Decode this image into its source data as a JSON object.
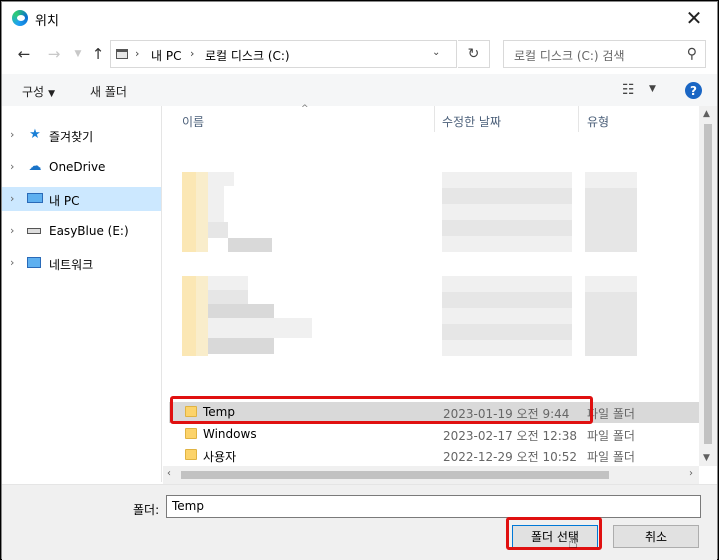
{
  "window": {
    "title": "위치"
  },
  "nav": {
    "breadcrumbs": [
      "내 PC",
      "로컬 디스크 (C:)"
    ],
    "search_placeholder": "로컬 디스크 (C:) 검색"
  },
  "commands": {
    "organize": "구성",
    "new_folder": "새 폴더"
  },
  "sidebar": {
    "items": [
      {
        "label": "즐겨찾기",
        "icon": "star-icon",
        "selected": false
      },
      {
        "label": "OneDrive",
        "icon": "cloud-icon",
        "selected": false
      },
      {
        "label": "내 PC",
        "icon": "computer-icon",
        "selected": true
      },
      {
        "label": "EasyBlue (E:)",
        "icon": "drive-icon",
        "selected": false
      },
      {
        "label": "네트워크",
        "icon": "network-icon",
        "selected": false
      }
    ]
  },
  "columns": {
    "name": "이름",
    "date": "수정한 날짜",
    "type": "유형"
  },
  "files": [
    {
      "name": "Temp",
      "date": "2023-01-19 오전 9:44",
      "type": "파일 폴더",
      "highlighted": true
    },
    {
      "name": "Windows",
      "date": "2023-02-17 오전 12:38",
      "type": "파일 폴더",
      "highlighted": false
    },
    {
      "name": "사용자",
      "date": "2022-12-29 오전 10:52",
      "type": "파일 폴더",
      "highlighted": false
    }
  ],
  "footer": {
    "folder_label": "폴더:",
    "folder_value": "Temp",
    "select_button": "폴더 선택",
    "cancel_button": "취소"
  },
  "colors": {
    "highlight_red": "#e01010",
    "selection_blue": "#cce8ff",
    "accent": "#0078d7"
  }
}
